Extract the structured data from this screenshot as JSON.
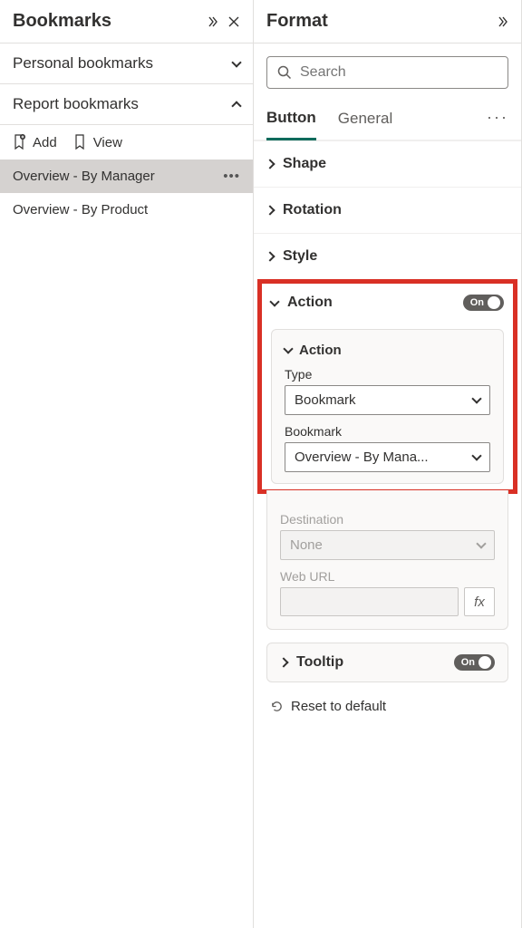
{
  "bookmarks_panel": {
    "title": "Bookmarks",
    "sections": {
      "personal": {
        "label": "Personal bookmarks"
      },
      "report": {
        "label": "Report bookmarks"
      }
    },
    "toolbar": {
      "add": "Add",
      "view": "View"
    },
    "items": [
      {
        "label": "Overview - By Manager",
        "selected": true
      },
      {
        "label": "Overview - By Product",
        "selected": false
      }
    ]
  },
  "format_panel": {
    "title": "Format",
    "search_placeholder": "Search",
    "tabs": {
      "button": "Button",
      "general": "General"
    },
    "props": {
      "shape": "Shape",
      "rotation": "Rotation",
      "style": "Style",
      "action": "Action",
      "tooltip": "Tooltip"
    },
    "action_toggle": "On",
    "tooltip_toggle": "On",
    "action_card": {
      "subhead": "Action",
      "type_label": "Type",
      "type_value": "Bookmark",
      "bookmark_label": "Bookmark",
      "bookmark_value": "Overview - By Mana...",
      "destination_label": "Destination",
      "destination_value": "None",
      "weburl_label": "Web URL"
    },
    "fx_label": "fx",
    "reset_label": "Reset to default"
  }
}
